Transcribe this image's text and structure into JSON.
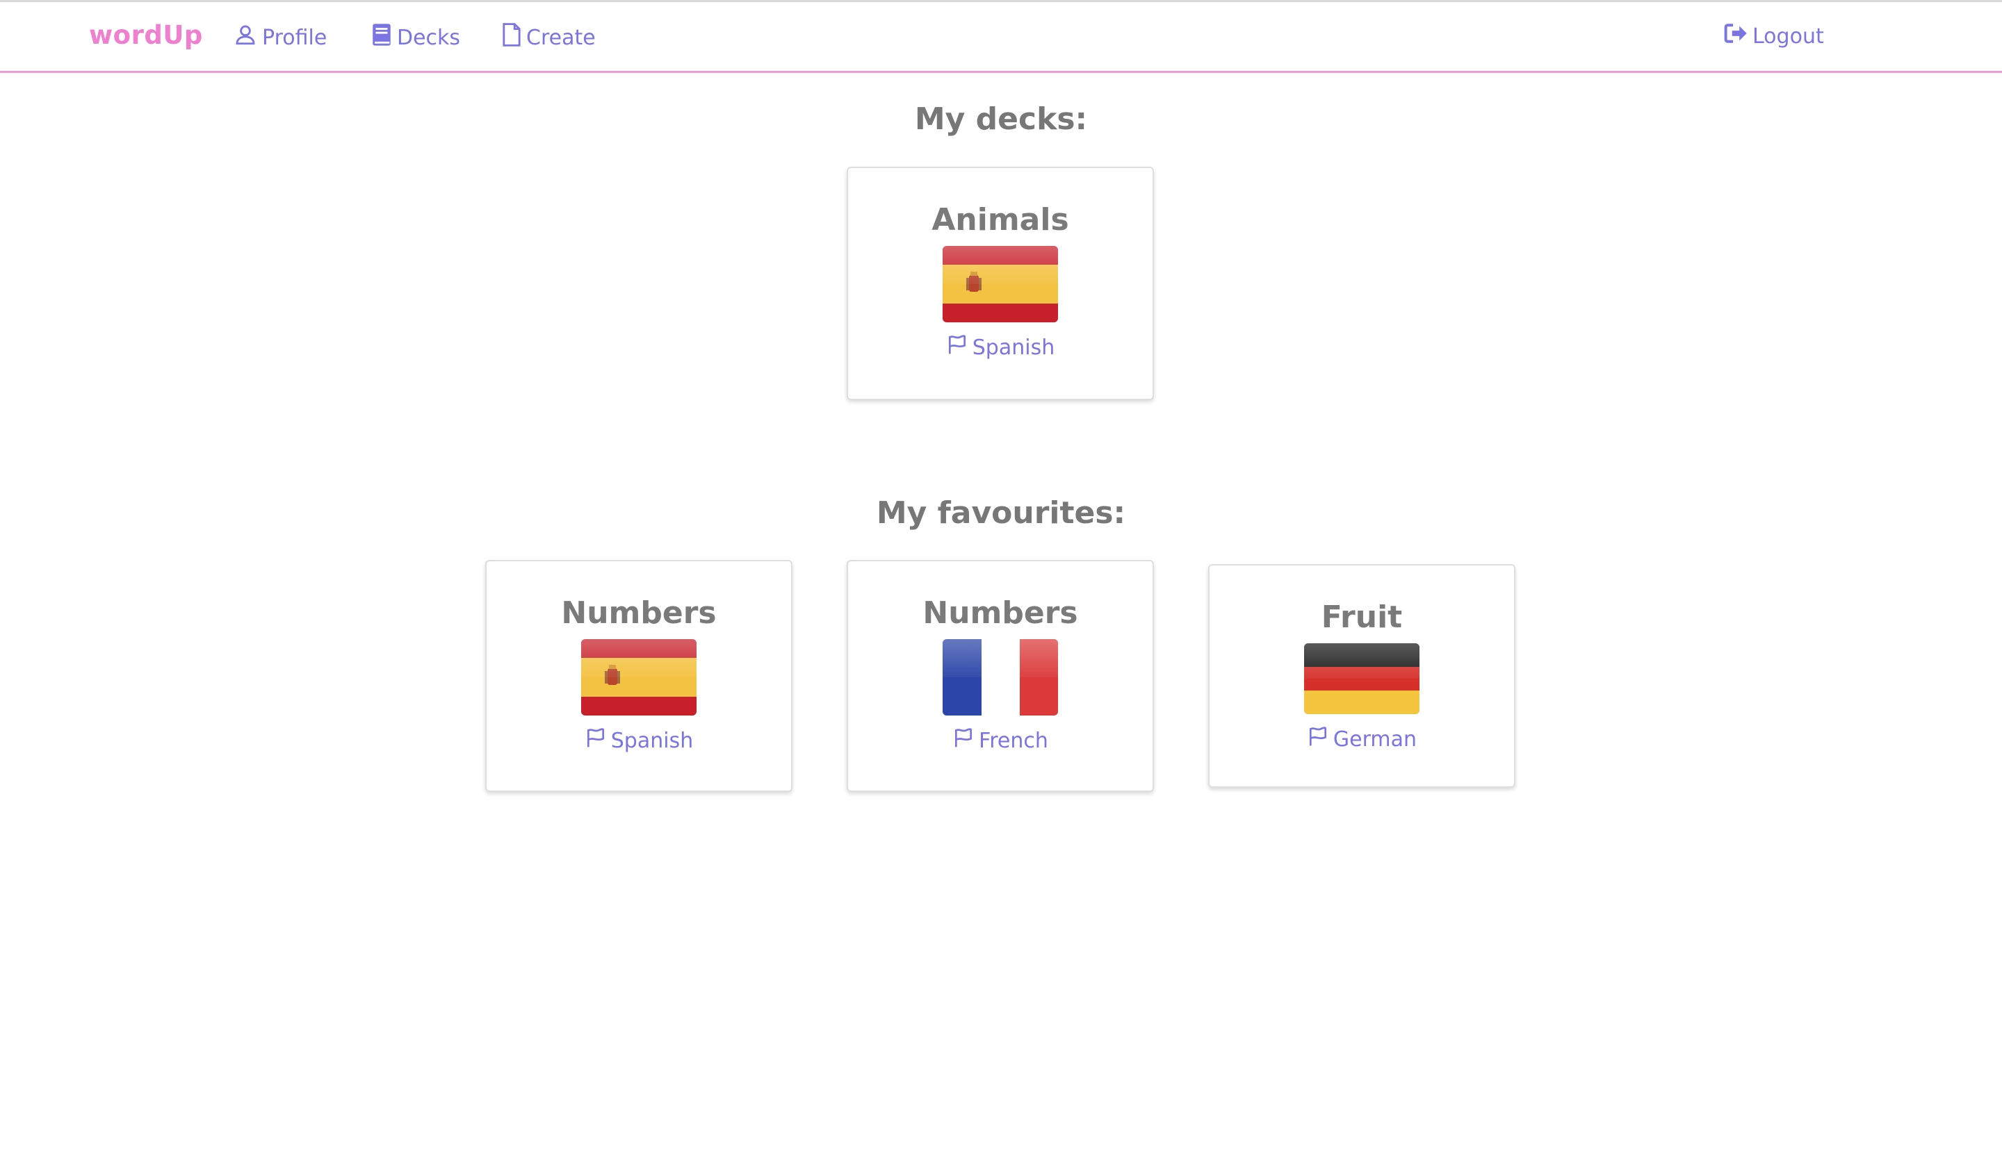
{
  "nav": {
    "brand": "wordUp",
    "profile": "Profile",
    "decks": "Decks",
    "create": "Create",
    "logout": "Logout"
  },
  "sections": {
    "my_decks_title": "My decks:",
    "favourites_title": "My favourites:"
  },
  "my_decks": [
    {
      "title": "Animals",
      "language": "Spanish",
      "flag": "spain-flag"
    }
  ],
  "favourites": [
    {
      "title": "Numbers",
      "language": "Spanish",
      "flag": "spain-flag"
    },
    {
      "title": "Numbers",
      "language": "French",
      "flag": "france-flag"
    },
    {
      "title": "Fruit",
      "language": "German",
      "flag": "germany-flag"
    }
  ],
  "colors": {
    "brand": "#f07fcf",
    "link": "#7b74e3",
    "heading": "#777777",
    "navbar_border": "#f29ad8"
  }
}
